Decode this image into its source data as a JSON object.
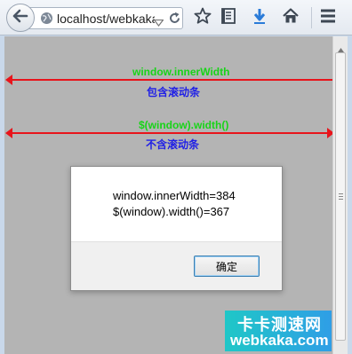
{
  "browser": {
    "url": "localhost/webkaka",
    "icons": [
      "back-arrow-icon",
      "globe-icon",
      "dropdown-arrow-icon",
      "reload-icon",
      "star-icon",
      "reading-list-icon",
      "download-icon",
      "home-icon",
      "menu-icon"
    ]
  },
  "page": {
    "inner_width_label": "window.innerWidth",
    "inner_width_note": "包含滚动条",
    "jquery_width_label": "$(window).width()",
    "jquery_width_note": "不含滚动条",
    "arrow_color": "#e8141b",
    "label_green": "#18d418",
    "label_blue": "#2020e6"
  },
  "dialog": {
    "line1": "window.innerWidth=384",
    "line2": "$(window).width()=367",
    "ok_label": "确定"
  },
  "watermark": {
    "cn": "卡卡测速网",
    "en": "webkaka.com"
  }
}
